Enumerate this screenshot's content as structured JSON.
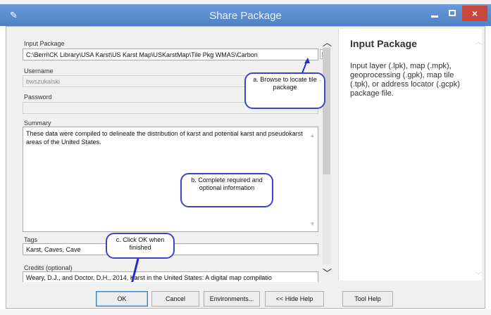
{
  "window": {
    "title": "Share Package",
    "close_glyph": "×",
    "app_icon": "pen-icon",
    "colors": {
      "titlebar": "#5d8ed0",
      "close": "#c9463d",
      "callout_border": "#3a46c8"
    }
  },
  "form": {
    "input_package": {
      "label": "Input Package",
      "value": "C:\\Berri\\CK Library\\USA Karst\\US Karst Map\\USKarstMap\\Tile Pkg WMAS\\Carbon"
    },
    "username": {
      "label": "Username",
      "value": "bwszukalski"
    },
    "password": {
      "label": "Password",
      "value": ""
    },
    "summary": {
      "label": "Summary",
      "value": "These data were compiled to delineate the distribution of karst and potential karst and pseudokarst areas of the United States."
    },
    "tags": {
      "label": "Tags",
      "value": "Karst, Caves, Cave"
    },
    "credits": {
      "label": "Credits (optional)",
      "value": "Weary, D.J., and Doctor, D.H., 2014, Karst in the United States: A digital map compilatio"
    }
  },
  "callouts": {
    "a": "a. Browse to locate tile package",
    "b": "b. Complete required and optional information",
    "c": "c. Click OK when finished"
  },
  "help": {
    "title": "Input Package",
    "body": "Input layer (.lpk), map (.mpk), geoprocessing (.gpk), map tile (.tpk), or address locator (.gcpk) package file."
  },
  "buttons": {
    "ok": "OK",
    "cancel": "Cancel",
    "environments": "Environments...",
    "hide_help": "<< Hide Help",
    "tool_help": "Tool Help"
  }
}
